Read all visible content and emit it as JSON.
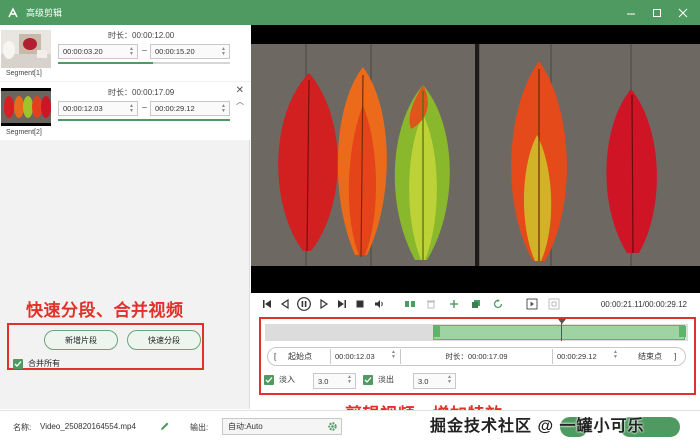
{
  "titlebar": {
    "title": "高级剪辑"
  },
  "segments": [
    {
      "label": "Segment[1]",
      "duration": "时长：00:00:12.00",
      "start": "00:00:03.20",
      "end": "00:00:15.20",
      "fill_start": 0.0,
      "fill_end": 0.55
    },
    {
      "label": "Segment[2]",
      "duration": "时长：00:00:17.09",
      "start": "00:00:12.03",
      "end": "00:00:29.12",
      "fill_start": 0.0,
      "fill_end": 1.0
    }
  ],
  "annotations": {
    "left": "快速分段、合并视频",
    "right": "剪辑视频、增加特效"
  },
  "left_actions": {
    "add_segment": "新增片段",
    "quick_split": "快速分段",
    "merge_all": "合并所有"
  },
  "player": {
    "timecode": "00:00:21.11/00:00:29.12",
    "selection_start": 0.405,
    "selection_end": 1.0,
    "playhead": 0.7
  },
  "range": {
    "start_label": "起始点",
    "start_value": "00:00:12.03",
    "duration_label": "时长：00:00:17.09",
    "end_value": "00:00:29.12",
    "end_label": "结束点"
  },
  "effects": {
    "fade_in_label": "淡入",
    "fade_in_value": "3.0",
    "fade_out_label": "淡出",
    "fade_out_value": "3.0"
  },
  "bottom": {
    "name_label": "名称:",
    "name_value": "Video_250820164554.mp4",
    "output_label": "输出:",
    "output_value": "自动:Auto"
  },
  "watermark": "掘金技术社区 @ 一罐小可乐",
  "colors": {
    "accent": "#4f9a61",
    "annotation": "#e0322a"
  }
}
